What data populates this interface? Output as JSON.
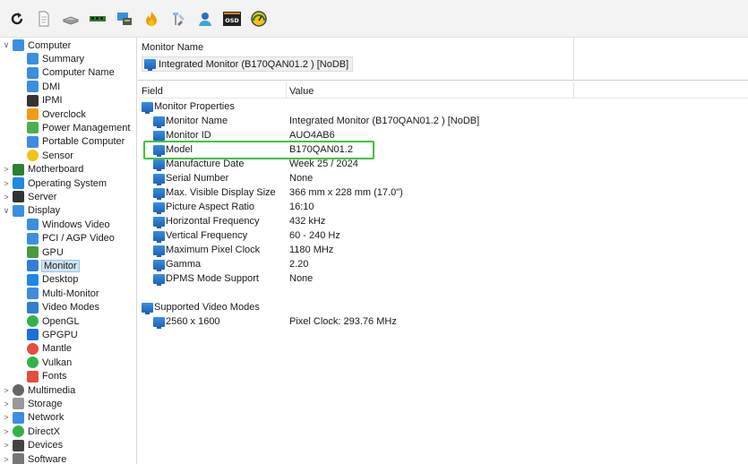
{
  "toolbar": {
    "buttons": [
      {
        "icon": "refresh-icon"
      },
      {
        "icon": "report-icon"
      },
      {
        "icon": "drive-icon"
      },
      {
        "icon": "memory-icon"
      },
      {
        "icon": "network-icon"
      },
      {
        "icon": "flame-icon"
      },
      {
        "icon": "tools-icon"
      },
      {
        "icon": "user-icon"
      },
      {
        "icon": "osd-icon",
        "text": "OSD"
      },
      {
        "icon": "gauge-icon"
      }
    ]
  },
  "tree": {
    "items": [
      {
        "label": "Computer",
        "chevron": "∨",
        "level": 0,
        "icon": "computer-icon"
      },
      {
        "label": "Summary",
        "chevron": "",
        "level": 1,
        "icon": "summary-icon"
      },
      {
        "label": "Computer Name",
        "chevron": "",
        "level": 1,
        "icon": "computer-name-icon"
      },
      {
        "label": "DMI",
        "chevron": "",
        "level": 1,
        "icon": "dmi-icon"
      },
      {
        "label": "IPMI",
        "chevron": "",
        "level": 1,
        "icon": "ipmi-icon"
      },
      {
        "label": "Overclock",
        "chevron": "",
        "level": 1,
        "icon": "flame-icon"
      },
      {
        "label": "Power Management",
        "chevron": "",
        "level": 1,
        "icon": "power-icon"
      },
      {
        "label": "Portable Computer",
        "chevron": "",
        "level": 1,
        "icon": "laptop-icon"
      },
      {
        "label": "Sensor",
        "chevron": "",
        "level": 1,
        "icon": "gauge-icon"
      },
      {
        "label": "Motherboard",
        "chevron": ">",
        "level": 0,
        "icon": "motherboard-icon"
      },
      {
        "label": "Operating System",
        "chevron": ">",
        "level": 0,
        "icon": "windows-icon"
      },
      {
        "label": "Server",
        "chevron": ">",
        "level": 0,
        "icon": "server-icon"
      },
      {
        "label": "Display",
        "chevron": "∨",
        "level": 0,
        "icon": "display-icon"
      },
      {
        "label": "Windows Video",
        "chevron": "",
        "level": 1,
        "icon": "video-card-icon"
      },
      {
        "label": "PCI / AGP Video",
        "chevron": "",
        "level": 1,
        "icon": "video-card-icon"
      },
      {
        "label": "GPU",
        "chevron": "",
        "level": 1,
        "icon": "gpu-icon"
      },
      {
        "label": "Monitor",
        "chevron": "",
        "level": 1,
        "icon": "monitor-icon",
        "selected": true
      },
      {
        "label": "Desktop",
        "chevron": "",
        "level": 1,
        "icon": "desktop-icon"
      },
      {
        "label": "Multi-Monitor",
        "chevron": "",
        "level": 1,
        "icon": "multi-monitor-icon"
      },
      {
        "label": "Video Modes",
        "chevron": "",
        "level": 1,
        "icon": "monitor-icon"
      },
      {
        "label": "OpenGL",
        "chevron": "",
        "level": 1,
        "icon": "opengl-icon"
      },
      {
        "label": "GPGPU",
        "chevron": "",
        "level": 1,
        "icon": "gpgpu-icon"
      },
      {
        "label": "Mantle",
        "chevron": "",
        "level": 1,
        "icon": "mantle-icon"
      },
      {
        "label": "Vulkan",
        "chevron": "",
        "level": 1,
        "icon": "vulkan-icon"
      },
      {
        "label": "Fonts",
        "chevron": "",
        "level": 1,
        "icon": "fonts-icon"
      },
      {
        "label": "Multimedia",
        "chevron": ">",
        "level": 0,
        "icon": "multimedia-icon"
      },
      {
        "label": "Storage",
        "chevron": ">",
        "level": 0,
        "icon": "storage-icon"
      },
      {
        "label": "Network",
        "chevron": ">",
        "level": 0,
        "icon": "network-icon"
      },
      {
        "label": "DirectX",
        "chevron": ">",
        "level": 0,
        "icon": "directx-icon"
      },
      {
        "label": "Devices",
        "chevron": ">",
        "level": 0,
        "icon": "devices-icon"
      },
      {
        "label": "Software",
        "chevron": ">",
        "level": 0,
        "icon": "software-icon"
      }
    ]
  },
  "header": {
    "label": "Monitor Name",
    "value": "Integrated Monitor (B170QAN01.2 ) [NoDB]"
  },
  "grid": {
    "col_field": "Field",
    "col_value": "Value",
    "rows": [
      {
        "field": "Monitor Properties",
        "value": "",
        "indent": 0,
        "gap": false
      },
      {
        "field": "Monitor Name",
        "value": "Integrated Monitor (B170QAN01.2 ) [NoDB]",
        "indent": 1,
        "gap": false
      },
      {
        "field": "Monitor ID",
        "value": "AUO4AB6",
        "indent": 1,
        "gap": false
      },
      {
        "field": "Model",
        "value": "B170QAN01.2",
        "indent": 1,
        "gap": false
      },
      {
        "field": "Manufacture Date",
        "value": "Week 25 / 2024",
        "indent": 1,
        "gap": false
      },
      {
        "field": "Serial Number",
        "value": "None",
        "indent": 1,
        "gap": false
      },
      {
        "field": "Max. Visible Display Size",
        "value": "366 mm x 228 mm (17.0\")",
        "indent": 1,
        "gap": false
      },
      {
        "field": "Picture Aspect Ratio",
        "value": "16:10",
        "indent": 1,
        "gap": false
      },
      {
        "field": "Horizontal Frequency",
        "value": "432 kHz",
        "indent": 1,
        "gap": false
      },
      {
        "field": "Vertical Frequency",
        "value": "60 - 240 Hz",
        "indent": 1,
        "gap": false
      },
      {
        "field": "Maximum Pixel Clock",
        "value": "1180 MHz",
        "indent": 1,
        "gap": false
      },
      {
        "field": "Gamma",
        "value": "2.20",
        "indent": 1,
        "gap": false
      },
      {
        "field": "DPMS Mode Support",
        "value": "None",
        "indent": 1,
        "gap": false
      },
      {
        "field": "Supported Video Modes",
        "value": "",
        "indent": 0,
        "gap": true
      },
      {
        "field": "2560 x 1600",
        "value": "Pixel Clock: 293.76 MHz",
        "indent": 1,
        "gap": false
      }
    ]
  },
  "colors": {
    "accent": "#2f7fd6",
    "highlight": "#44c23a",
    "selection": "#cfe3f7"
  }
}
